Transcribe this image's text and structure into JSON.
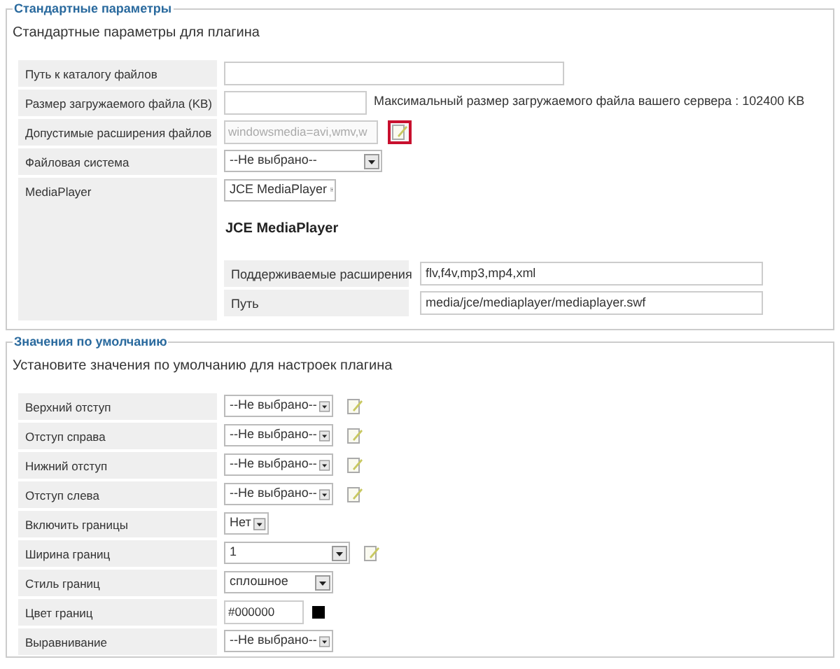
{
  "sections": [
    {
      "legend": "Стандартные параметры",
      "description": "Стандартные параметры для плагина",
      "fields": [
        {
          "kind": "text",
          "label": "Путь к каталогу файлов"
        },
        {
          "kind": "text",
          "label": "Размер загружаемого файла (KB)",
          "hint": "Максимальный размер загружаемого файла вашего сервера : 102400 KB"
        },
        {
          "kind": "text",
          "label": "Допустимые расширения файлов",
          "value": "windowsmedia=avi,wmv,w",
          "disabled": true,
          "edit_button": {
            "highlighted": true
          }
        },
        {
          "kind": "select",
          "label": "Файловая система",
          "value": "--Не выбрано--"
        },
        {
          "kind": "plugin",
          "label": "MediaPlayer",
          "value": "JCE MediaPlayer",
          "title": "JCE MediaPlayer",
          "options": [
            {
              "label": "Поддерживаемые расширения",
              "value": "flv,f4v,mp3,mp4,xml"
            },
            {
              "label": "Путь",
              "value": "media/jce/mediaplayer/mediaplayer.swf"
            }
          ]
        }
      ]
    },
    {
      "legend": "Значения по умолчанию",
      "description": "Установите значения по умолчанию для настроек плагина",
      "fields": [
        {
          "kind": "select",
          "label": "Верхний отступ",
          "value": "--Не выбрано--",
          "edit_button": {
            "highlighted": false
          }
        },
        {
          "kind": "select",
          "label": "Отступ справа",
          "value": "--Не выбрано--",
          "edit_button": {
            "highlighted": false
          }
        },
        {
          "kind": "select",
          "label": "Нижний отступ",
          "value": "--Не выбрано--",
          "edit_button": {
            "highlighted": false
          }
        },
        {
          "kind": "select",
          "label": "Отступ слева",
          "value": "--Не выбрано--",
          "edit_button": {
            "highlighted": false
          }
        },
        {
          "kind": "select",
          "label": "Включить границы",
          "value": "Нет"
        },
        {
          "kind": "select",
          "label": "Ширина границ",
          "value": "1",
          "edit_button": {
            "highlighted": false
          }
        },
        {
          "kind": "select",
          "label": "Стиль границ",
          "value": "сплошное"
        },
        {
          "kind": "color",
          "label": "Цвет границ",
          "value": "#000000",
          "color": "#000000"
        },
        {
          "kind": "select",
          "label": "Выравнивание",
          "value": "--Не выбрано--"
        }
      ]
    }
  ]
}
